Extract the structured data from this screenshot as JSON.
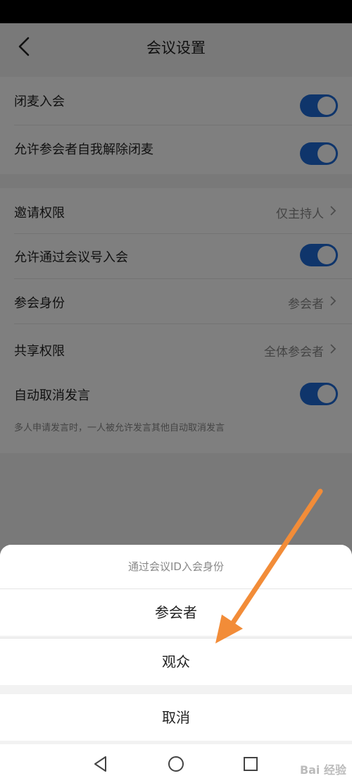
{
  "header": {
    "title": "会议设置"
  },
  "settings": {
    "mute_on_join": {
      "label": "闭麦入会",
      "enabled": true
    },
    "allow_unmute_self": {
      "label": "允许参会者自我解除闭麦",
      "enabled": true
    },
    "invite_permission": {
      "label": "邀请权限",
      "value": "仅主持人"
    },
    "allow_join_by_id": {
      "label": "允许通过会议号入会",
      "enabled": true
    },
    "attendee_role": {
      "label": "参会身份",
      "value": "参会者"
    },
    "share_permission": {
      "label": "共享权限",
      "value": "全体参会者"
    },
    "auto_cancel_speak": {
      "label": "自动取消发言",
      "enabled": true,
      "hint": "多人申请发言时，一人被允许发言其他自动取消发言"
    }
  },
  "sheet": {
    "title": "通过会议ID入会身份",
    "options": [
      "参会者",
      "观众"
    ],
    "cancel": "取消"
  },
  "watermark": "Bai 经验",
  "colors": {
    "toggle_on": "#1e6bd6",
    "arrow": "#f28c38"
  }
}
